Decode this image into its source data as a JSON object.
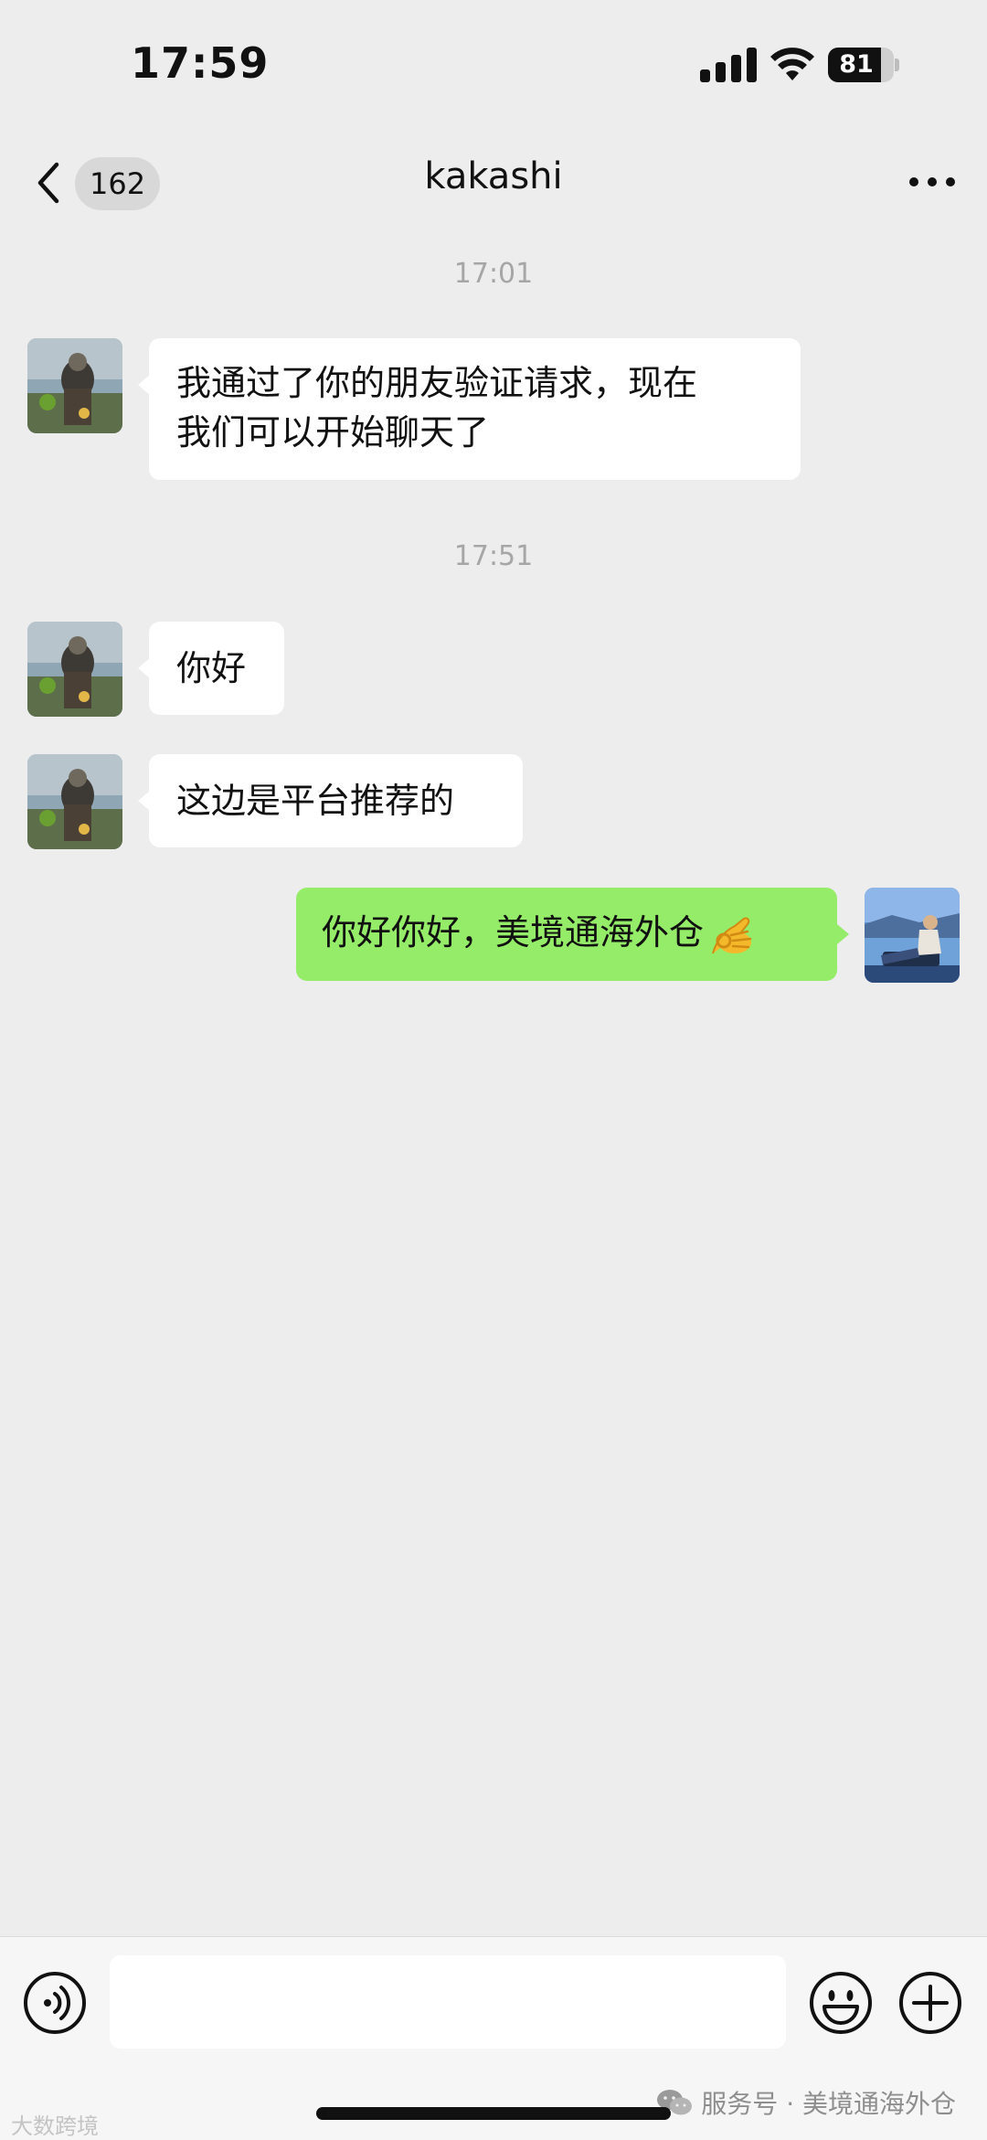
{
  "status_bar": {
    "time": "17:59",
    "battery_level": "81",
    "battery_fraction": 0.81
  },
  "nav": {
    "back_icon": "chevron-left-icon",
    "unread_count": "162",
    "title": "kakashi",
    "more_icon": "more-horizontal-icon"
  },
  "messages": {
    "timestamp_1": "17:01",
    "msg_1": {
      "direction": "incoming",
      "text_line_1": "我通过了你的朋友验证请求，现在",
      "text_line_2": "我们可以开始聊天了"
    },
    "timestamp_2": "17:51",
    "msg_2": {
      "direction": "incoming",
      "text": "你好"
    },
    "msg_3": {
      "direction": "incoming",
      "text": "这边是平台推荐的"
    },
    "msg_4": {
      "direction": "outgoing",
      "text": "你好你好，美境通海外仓",
      "emoji": "ok-hand-emoji"
    }
  },
  "input_bar": {
    "voice_icon": "voice-icon",
    "emoji_icon": "smiley-icon",
    "plus_icon": "plus-circle-icon",
    "input_value": ""
  },
  "watermarks": {
    "left": "大数跨境",
    "right_service": "服务号 · 美境通海外仓"
  },
  "colors": {
    "background": "#ededed",
    "incoming_bubble": "#ffffff",
    "outgoing_bubble": "#95ec69",
    "timestamp": "#a6a6a6"
  }
}
